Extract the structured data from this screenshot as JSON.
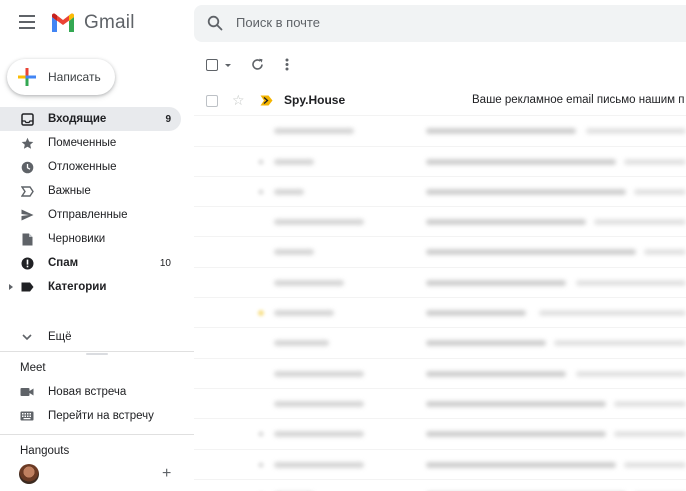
{
  "app": {
    "name": "Gmail",
    "brand_colors": {
      "red": "#ea4335",
      "blue": "#4285f4",
      "green": "#34a853",
      "yellow": "#fbbc04"
    }
  },
  "search": {
    "placeholder": "Поиск в почте"
  },
  "compose": {
    "label": "Написать"
  },
  "sidebar": {
    "items": [
      {
        "label": "Входящие",
        "icon": "inbox-icon",
        "count": "9",
        "active": true,
        "bold": true
      },
      {
        "label": "Помеченные",
        "icon": "star-icon",
        "count": "",
        "active": false,
        "bold": false
      },
      {
        "label": "Отложенные",
        "icon": "clock-icon",
        "count": "",
        "active": false,
        "bold": false
      },
      {
        "label": "Важные",
        "icon": "important-icon",
        "count": "",
        "active": false,
        "bold": false
      },
      {
        "label": "Отправленные",
        "icon": "send-icon",
        "count": "",
        "active": false,
        "bold": false
      },
      {
        "label": "Черновики",
        "icon": "draft-icon",
        "count": "",
        "active": false,
        "bold": false
      },
      {
        "label": "Спам",
        "icon": "spam-icon",
        "count": "10",
        "active": false,
        "bold": true
      },
      {
        "label": "Категории",
        "icon": "label-icon",
        "count": "",
        "active": false,
        "bold": true
      }
    ],
    "more_label": "Ещё"
  },
  "meet": {
    "title": "Meet",
    "items": [
      {
        "label": "Новая встреча",
        "icon": "video-camera-icon"
      },
      {
        "label": "Перейти на встречу",
        "icon": "keyboard-icon"
      }
    ]
  },
  "hangouts": {
    "title": "Hangouts"
  },
  "email_list": {
    "first_row": {
      "sender": "Spy.House",
      "subject": "Ваше рекламное email письмо нашим п"
    }
  }
}
